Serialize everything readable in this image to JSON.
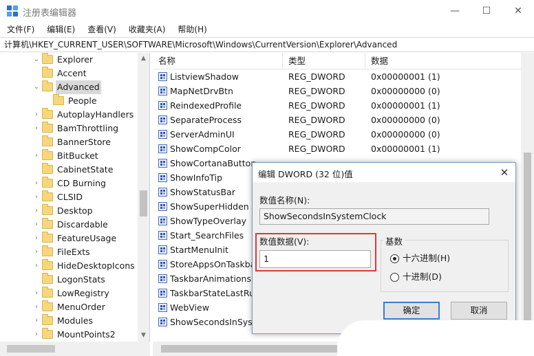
{
  "window": {
    "title": "注册表编辑器",
    "minimize": "—",
    "maximize": "☐",
    "close": "✕"
  },
  "menu": [
    "文件(F)",
    "编辑(E)",
    "查看(V)",
    "收藏夹(A)",
    "帮助(H)"
  ],
  "address": "计算机\\HKEY_CURRENT_USER\\SOFTWARE\\Microsoft\\Windows\\CurrentVersion\\Explorer\\Advanced",
  "tree": [
    {
      "label": "Explorer",
      "arrow": "⌄",
      "selected": false
    },
    {
      "label": "Accent",
      "arrow": "",
      "selected": false
    },
    {
      "label": "Advanced",
      "arrow": "⌄",
      "selected": true
    },
    {
      "label": "People",
      "arrow": "",
      "selected": false
    },
    {
      "label": "AutoplayHandlers",
      "arrow": "›",
      "selected": false
    },
    {
      "label": "BamThrottling",
      "arrow": "›",
      "selected": false
    },
    {
      "label": "BannerStore",
      "arrow": "",
      "selected": false
    },
    {
      "label": "BitBucket",
      "arrow": "›",
      "selected": false
    },
    {
      "label": "CabinetState",
      "arrow": "",
      "selected": false
    },
    {
      "label": "CD Burning",
      "arrow": "›",
      "selected": false
    },
    {
      "label": "CLSID",
      "arrow": "›",
      "selected": false
    },
    {
      "label": "Desktop",
      "arrow": "›",
      "selected": false
    },
    {
      "label": "Discardable",
      "arrow": "›",
      "selected": false
    },
    {
      "label": "FeatureUsage",
      "arrow": "›",
      "selected": false
    },
    {
      "label": "FileExts",
      "arrow": "›",
      "selected": false
    },
    {
      "label": "HideDesktopIcons",
      "arrow": "›",
      "selected": false
    },
    {
      "label": "LogonStats",
      "arrow": "",
      "selected": false
    },
    {
      "label": "LowRegistry",
      "arrow": "›",
      "selected": false
    },
    {
      "label": "MenuOrder",
      "arrow": "›",
      "selected": false
    },
    {
      "label": "Modules",
      "arrow": "›",
      "selected": false
    },
    {
      "label": "MountPoints2",
      "arrow": "›",
      "selected": false
    }
  ],
  "list": {
    "headers": {
      "name": "名称",
      "type": "类型",
      "data": "数据"
    },
    "rows": [
      {
        "name": "ListviewShadow",
        "type": "REG_DWORD",
        "data": "0x00000001 (1)"
      },
      {
        "name": "MapNetDrvBtn",
        "type": "REG_DWORD",
        "data": "0x00000000 (0)"
      },
      {
        "name": "ReindexedProfile",
        "type": "REG_DWORD",
        "data": "0x00000001 (1)"
      },
      {
        "name": "SeparateProcess",
        "type": "REG_DWORD",
        "data": "0x00000000 (0)"
      },
      {
        "name": "ServerAdminUI",
        "type": "REG_DWORD",
        "data": "0x00000000 (0)"
      },
      {
        "name": "ShowCompColor",
        "type": "REG_DWORD",
        "data": "0x00000001 (1)"
      },
      {
        "name": "ShowCortanaButton",
        "type": "",
        "data": ""
      },
      {
        "name": "ShowInfoTip",
        "type": "",
        "data": ""
      },
      {
        "name": "ShowStatusBar",
        "type": "",
        "data": ""
      },
      {
        "name": "ShowSuperHidden",
        "type": "",
        "data": ""
      },
      {
        "name": "ShowTypeOverlay",
        "type": "",
        "data": ""
      },
      {
        "name": "Start_SearchFiles",
        "type": "",
        "data": ""
      },
      {
        "name": "StartMenuInit",
        "type": "",
        "data": ""
      },
      {
        "name": "StoreAppsOnTaskba",
        "type": "",
        "data": ""
      },
      {
        "name": "TaskbarAnimations",
        "type": "",
        "data": ""
      },
      {
        "name": "TaskbarStateLastRu",
        "type": "",
        "data": ""
      },
      {
        "name": "WebView",
        "type": "",
        "data": ""
      },
      {
        "name": "ShowSecondsInSyste",
        "type": "",
        "data": ""
      }
    ]
  },
  "dialog": {
    "title": "编辑 DWORD (32 位)值",
    "close": "✕",
    "value_name_label": "数值名称(N):",
    "value_name": "ShowSecondsInSystemClock",
    "value_data_label": "数值数据(V):",
    "value_data": "1",
    "base_label": "基数",
    "hex_label": "十六进制(H)",
    "dec_label": "十进制(D)",
    "base_selected": "hex",
    "ok": "确定",
    "cancel": "取消"
  },
  "colors": {
    "highlight_box": "#d93a3a",
    "default_button_border": "#3b7bd4",
    "folder": "#f6d77e"
  }
}
